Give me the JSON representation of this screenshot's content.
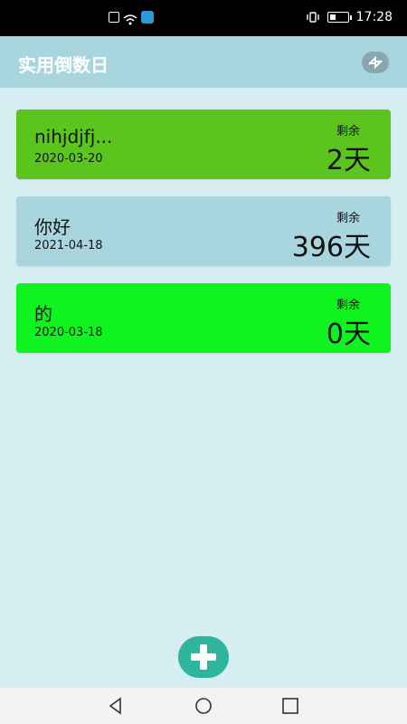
{
  "status_bar": {
    "time": "17:28",
    "icons": [
      "sim-icon",
      "wifi-icon",
      "ai-app-icon",
      "vibrate-icon",
      "battery-icon"
    ]
  },
  "app_bar": {
    "title": "实用倒数日",
    "action_icon": "sort-icon"
  },
  "events": [
    {
      "name": "nihjdjfj...",
      "date": "2020-03-20",
      "label": "剩余",
      "days": "2天",
      "color": "#5cc51d"
    },
    {
      "name": "你好",
      "date": "2021-04-18",
      "label": "剩余",
      "days": "396天",
      "color": "#a9d6de"
    },
    {
      "name": "的",
      "date": "2020-03-18",
      "label": "剩余",
      "days": "0天",
      "color": "#0ff41f"
    }
  ],
  "fab": {
    "icon": "plus-icon",
    "color": "#2fb59e"
  },
  "nav_bar": {
    "icons": [
      "back-icon",
      "home-icon",
      "recent-apps-icon"
    ]
  }
}
